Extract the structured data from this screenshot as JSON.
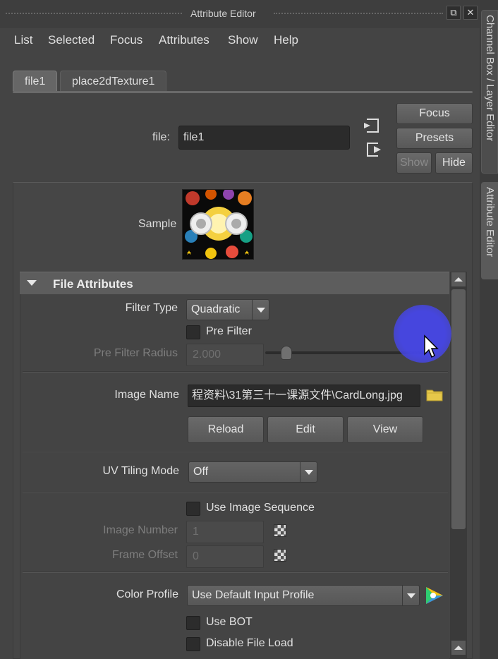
{
  "window": {
    "title": "Attribute Editor"
  },
  "menu": [
    "List",
    "Selected",
    "Focus",
    "Attributes",
    "Show",
    "Help"
  ],
  "tabs": [
    "file1",
    "place2dTexture1"
  ],
  "node": {
    "label": "file:",
    "value": "file1"
  },
  "buttons": {
    "focus": "Focus",
    "presets": "Presets",
    "show": "Show",
    "hide": "Hide"
  },
  "sample": {
    "label": "Sample"
  },
  "section": {
    "title": "File Attributes"
  },
  "filter_type": {
    "label": "Filter Type",
    "value": "Quadratic"
  },
  "pre_filter": {
    "label": "Pre Filter"
  },
  "pre_filter_radius": {
    "label": "Pre Filter Radius",
    "value": "2.000"
  },
  "image_name": {
    "label": "Image Name",
    "value": "程资料\\31第三十一课源文件\\CardLong.jpg"
  },
  "image_buttons": {
    "reload": "Reload",
    "edit": "Edit",
    "view": "View"
  },
  "uv_tiling": {
    "label": "UV Tiling Mode",
    "value": "Off"
  },
  "image_sequence": {
    "label": "Use Image Sequence"
  },
  "image_number": {
    "label": "Image Number",
    "value": "1"
  },
  "frame_offset": {
    "label": "Frame Offset",
    "value": "0"
  },
  "color_profile": {
    "label": "Color Profile",
    "value": "Use Default Input Profile"
  },
  "use_bot": {
    "label": "Use BOT"
  },
  "disable_file_load": {
    "label": "Disable File Load"
  },
  "side_tabs": [
    "Channel Box / Layer Editor",
    "Attribute Editor"
  ],
  "colors": {
    "background": "#444444",
    "section_header": "#5d5d5d",
    "cursor_highlight": "#4646e6",
    "folder": "#e6c84a"
  }
}
